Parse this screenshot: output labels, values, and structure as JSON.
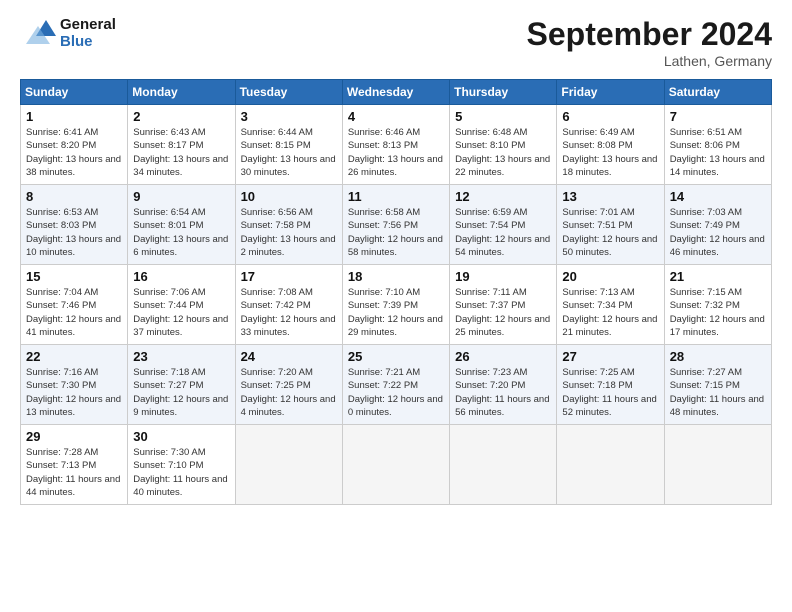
{
  "header": {
    "logo_general": "General",
    "logo_blue": "Blue",
    "month_title": "September 2024",
    "location": "Lathen, Germany"
  },
  "weekdays": [
    "Sunday",
    "Monday",
    "Tuesday",
    "Wednesday",
    "Thursday",
    "Friday",
    "Saturday"
  ],
  "weeks": [
    [
      {
        "day": "1",
        "rise": "6:41 AM",
        "set": "8:20 PM",
        "daylight": "13 hours and 38 minutes."
      },
      {
        "day": "2",
        "rise": "6:43 AM",
        "set": "8:17 PM",
        "daylight": "13 hours and 34 minutes."
      },
      {
        "day": "3",
        "rise": "6:44 AM",
        "set": "8:15 PM",
        "daylight": "13 hours and 30 minutes."
      },
      {
        "day": "4",
        "rise": "6:46 AM",
        "set": "8:13 PM",
        "daylight": "13 hours and 26 minutes."
      },
      {
        "day": "5",
        "rise": "6:48 AM",
        "set": "8:10 PM",
        "daylight": "13 hours and 22 minutes."
      },
      {
        "day": "6",
        "rise": "6:49 AM",
        "set": "8:08 PM",
        "daylight": "13 hours and 18 minutes."
      },
      {
        "day": "7",
        "rise": "6:51 AM",
        "set": "8:06 PM",
        "daylight": "13 hours and 14 minutes."
      }
    ],
    [
      {
        "day": "8",
        "rise": "6:53 AM",
        "set": "8:03 PM",
        "daylight": "13 hours and 10 minutes."
      },
      {
        "day": "9",
        "rise": "6:54 AM",
        "set": "8:01 PM",
        "daylight": "13 hours and 6 minutes."
      },
      {
        "day": "10",
        "rise": "6:56 AM",
        "set": "7:58 PM",
        "daylight": "13 hours and 2 minutes."
      },
      {
        "day": "11",
        "rise": "6:58 AM",
        "set": "7:56 PM",
        "daylight": "12 hours and 58 minutes."
      },
      {
        "day": "12",
        "rise": "6:59 AM",
        "set": "7:54 PM",
        "daylight": "12 hours and 54 minutes."
      },
      {
        "day": "13",
        "rise": "7:01 AM",
        "set": "7:51 PM",
        "daylight": "12 hours and 50 minutes."
      },
      {
        "day": "14",
        "rise": "7:03 AM",
        "set": "7:49 PM",
        "daylight": "12 hours and 46 minutes."
      }
    ],
    [
      {
        "day": "15",
        "rise": "7:04 AM",
        "set": "7:46 PM",
        "daylight": "12 hours and 41 minutes."
      },
      {
        "day": "16",
        "rise": "7:06 AM",
        "set": "7:44 PM",
        "daylight": "12 hours and 37 minutes."
      },
      {
        "day": "17",
        "rise": "7:08 AM",
        "set": "7:42 PM",
        "daylight": "12 hours and 33 minutes."
      },
      {
        "day": "18",
        "rise": "7:10 AM",
        "set": "7:39 PM",
        "daylight": "12 hours and 29 minutes."
      },
      {
        "day": "19",
        "rise": "7:11 AM",
        "set": "7:37 PM",
        "daylight": "12 hours and 25 minutes."
      },
      {
        "day": "20",
        "rise": "7:13 AM",
        "set": "7:34 PM",
        "daylight": "12 hours and 21 minutes."
      },
      {
        "day": "21",
        "rise": "7:15 AM",
        "set": "7:32 PM",
        "daylight": "12 hours and 17 minutes."
      }
    ],
    [
      {
        "day": "22",
        "rise": "7:16 AM",
        "set": "7:30 PM",
        "daylight": "12 hours and 13 minutes."
      },
      {
        "day": "23",
        "rise": "7:18 AM",
        "set": "7:27 PM",
        "daylight": "12 hours and 9 minutes."
      },
      {
        "day": "24",
        "rise": "7:20 AM",
        "set": "7:25 PM",
        "daylight": "12 hours and 4 minutes."
      },
      {
        "day": "25",
        "rise": "7:21 AM",
        "set": "7:22 PM",
        "daylight": "12 hours and 0 minutes."
      },
      {
        "day": "26",
        "rise": "7:23 AM",
        "set": "7:20 PM",
        "daylight": "11 hours and 56 minutes."
      },
      {
        "day": "27",
        "rise": "7:25 AM",
        "set": "7:18 PM",
        "daylight": "11 hours and 52 minutes."
      },
      {
        "day": "28",
        "rise": "7:27 AM",
        "set": "7:15 PM",
        "daylight": "11 hours and 48 minutes."
      }
    ],
    [
      {
        "day": "29",
        "rise": "7:28 AM",
        "set": "7:13 PM",
        "daylight": "11 hours and 44 minutes."
      },
      {
        "day": "30",
        "rise": "7:30 AM",
        "set": "7:10 PM",
        "daylight": "11 hours and 40 minutes."
      },
      null,
      null,
      null,
      null,
      null
    ]
  ]
}
